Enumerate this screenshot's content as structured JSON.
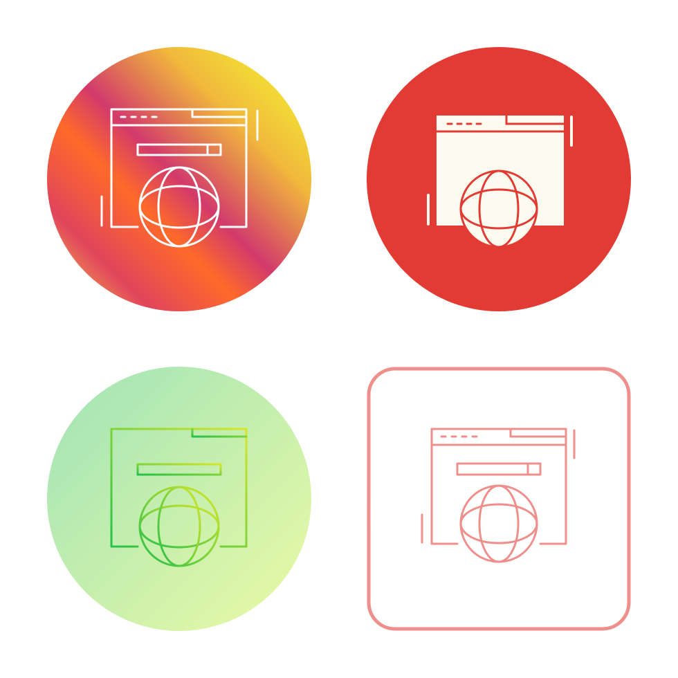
{
  "icon_set": {
    "icon": "browser-globe-icon",
    "variants": [
      {
        "name": "gradient-circle",
        "background": [
          "#f5ff2e",
          "#d23a6b",
          "#ff6a2a",
          "#ffd84a"
        ],
        "stroke": "#ffffff"
      },
      {
        "name": "solid-circle",
        "background": "#e23b33",
        "fill": "#fdfbf0",
        "stroke": "#e23b33"
      },
      {
        "name": "light-gradient-circle",
        "background": [
          "#a8e6b8",
          "#e6f9a8"
        ],
        "stroke": [
          "#25c04a",
          "#d8e62a"
        ]
      },
      {
        "name": "outline-rounded-square",
        "border": "#ee8f8c",
        "stroke": "#ee8f8c"
      }
    ]
  }
}
